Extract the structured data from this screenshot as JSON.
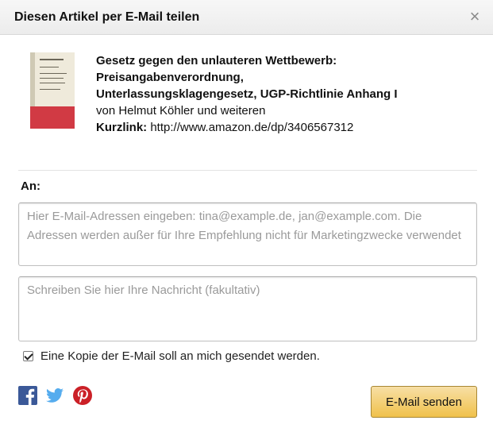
{
  "dialog": {
    "title": "Diesen Artikel per E-Mail teilen",
    "close_symbol": "×"
  },
  "product": {
    "title_line1": "Gesetz gegen den unlauteren Wettbewerb:",
    "title_line2": "Preisangabenverordnung,",
    "title_line3": "Unterlassungsklagengesetz, UGP-Richtlinie Anhang I",
    "author": "von Helmut Köhler und weiteren",
    "kurzlink_label": "Kurzlink:",
    "kurzlink_url": "http://www.amazon.de/dp/3406567312",
    "cover_colors": {
      "paper": "#efeadb",
      "band": "#d13a44"
    }
  },
  "form": {
    "to_label": "An:",
    "email_placeholder": "Hier E-Mail-Adressen eingeben: tina@example.de, jan@example.com. Die Adressen werden außer für Ihre Empfehlung nicht für Marketingzwecke verwendet",
    "message_placeholder": "Schreiben Sie hier Ihre Nachricht (fakultativ)",
    "copy_label": "Eine Kopie der E-Mail soll an mich gesendet werden.",
    "copy_checked": true,
    "send_label": "E-Mail senden"
  },
  "social": [
    {
      "icon": "facebook-icon",
      "color": "#3b5998"
    },
    {
      "icon": "twitter-icon",
      "color": "#55acee"
    },
    {
      "icon": "pinterest-icon",
      "color": "#cb2027"
    }
  ],
  "colors": {
    "button_top": "#f7dfa5",
    "button_bottom": "#f0c14b",
    "button_border": "#a88734"
  }
}
